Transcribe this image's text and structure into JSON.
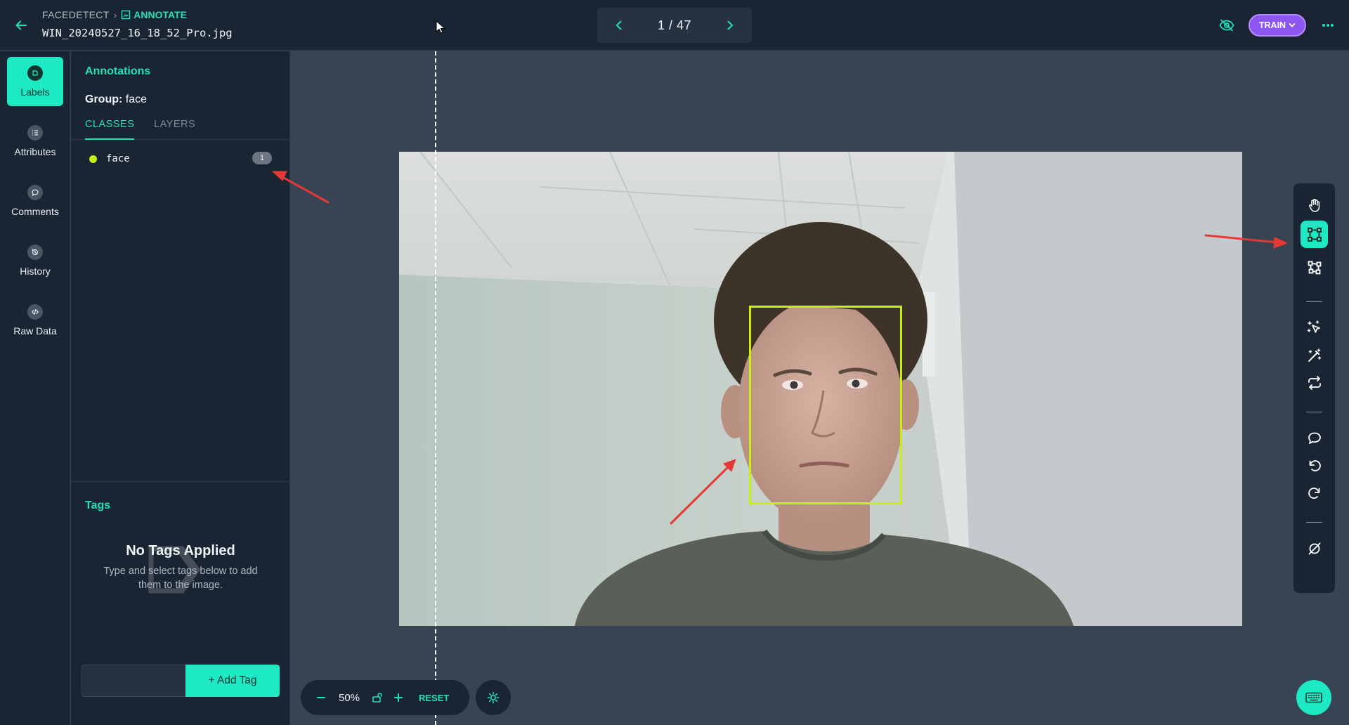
{
  "header": {
    "project": "FACEDETECT",
    "section": "ANNOTATE",
    "filename": "WIN_20240527_16_18_52_Pro.jpg",
    "pager": "1 / 47",
    "train_label": "TRAIN"
  },
  "rail": [
    {
      "label": "Labels",
      "icon": "label-icon",
      "active": true
    },
    {
      "label": "Attributes",
      "icon": "list-icon"
    },
    {
      "label": "Comments",
      "icon": "comment-icon"
    },
    {
      "label": "History",
      "icon": "history-icon"
    },
    {
      "label": "Raw Data",
      "icon": "code-icon"
    }
  ],
  "panel": {
    "title": "Annotations",
    "group_label": "Group:",
    "group_value": "face",
    "tabs": [
      "CLASSES",
      "LAYERS"
    ],
    "classes": [
      {
        "name": "face",
        "count": "1",
        "color": "#c8ee14"
      }
    ]
  },
  "tags": {
    "title": "Tags",
    "empty_title": "No Tags Applied",
    "empty_sub": "Type and select tags below to add them to the image.",
    "input_value": "",
    "add_label": "+ Add Tag"
  },
  "canvas": {
    "zoom": "50%",
    "reset_label": "RESET"
  },
  "toolbar": [
    "pan-hand-icon",
    "bounding-box-icon",
    "polygon-icon",
    "smart-select-icon",
    "magic-wand-icon",
    "repeat-icon",
    "comment-icon",
    "undo-icon",
    "redo-icon",
    "null-icon"
  ],
  "colors": {
    "accent": "#1de9c4",
    "panel_bg": "#1a2533",
    "canvas_bg": "#384353",
    "train": "#8e56f0",
    "bbox": "#c8ee14",
    "arrow": "#e53935"
  }
}
